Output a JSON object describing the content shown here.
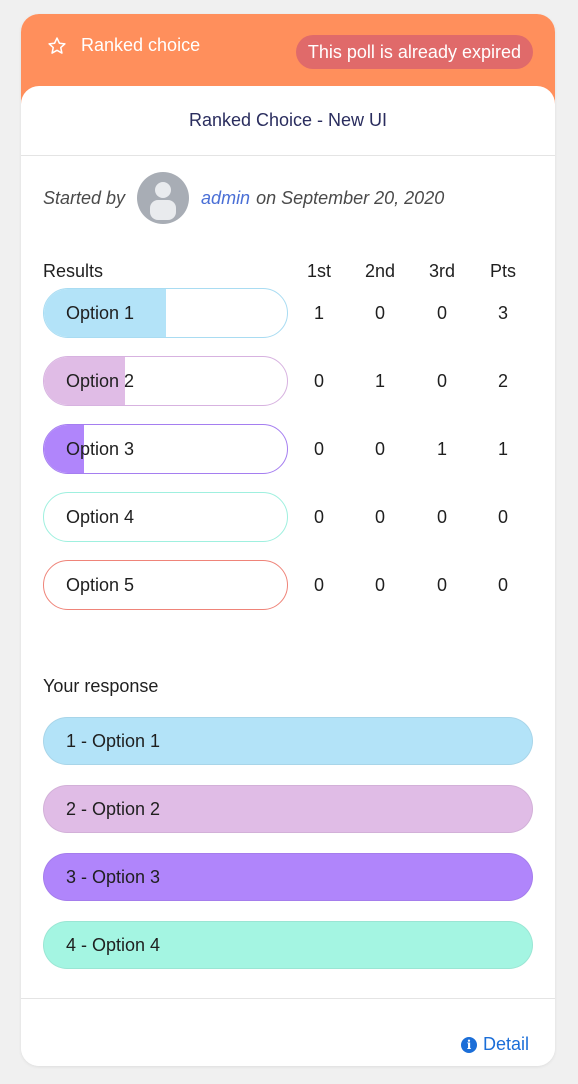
{
  "header": {
    "poll_type": "Ranked choice",
    "status_badge": "This poll is already expired"
  },
  "poll": {
    "title": "Ranked Choice - New UI",
    "started_by_label": "Started by",
    "author": "admin",
    "date_text": "on September 20, 2020"
  },
  "results": {
    "heading": "Results",
    "columns": [
      "1st",
      "2nd",
      "3rd",
      "Pts"
    ],
    "max_points": 3,
    "rows": [
      {
        "label": "Option 1",
        "first": "1",
        "second": "0",
        "third": "0",
        "points": "3",
        "fill_color": "#b3e3f8",
        "border_color": "#a9dcf2"
      },
      {
        "label": "Option 2",
        "first": "0",
        "second": "1",
        "third": "0",
        "points": "2",
        "fill_color": "#e0bce6",
        "border_color": "#d7b2e0"
      },
      {
        "label": "Option 3",
        "first": "0",
        "second": "0",
        "third": "1",
        "points": "1",
        "fill_color": "#b085fb",
        "border_color": "#a57ef0"
      },
      {
        "label": "Option 4",
        "first": "0",
        "second": "0",
        "third": "0",
        "points": "0",
        "fill_color": "#a4f5e2",
        "border_color": "#9ff0df"
      },
      {
        "label": "Option 5",
        "first": "0",
        "second": "0",
        "third": "0",
        "points": "0",
        "fill_color": "#f28a80",
        "border_color": "#ef8479"
      }
    ]
  },
  "your_response": {
    "heading": "Your response",
    "items": [
      {
        "label": "1 - Option 1",
        "color": "#b3e3f8"
      },
      {
        "label": "2 - Option 2",
        "color": "#e0bce6"
      },
      {
        "label": "3 - Option 3",
        "color": "#b085fb"
      },
      {
        "label": "4 - Option 4",
        "color": "#a4f5e2"
      }
    ]
  },
  "footer": {
    "detail_label": "Detail"
  },
  "colors": {
    "header_bg": "#ff8f5c",
    "badge_bg": "#e06a6a",
    "link": "#1b6ed8"
  }
}
